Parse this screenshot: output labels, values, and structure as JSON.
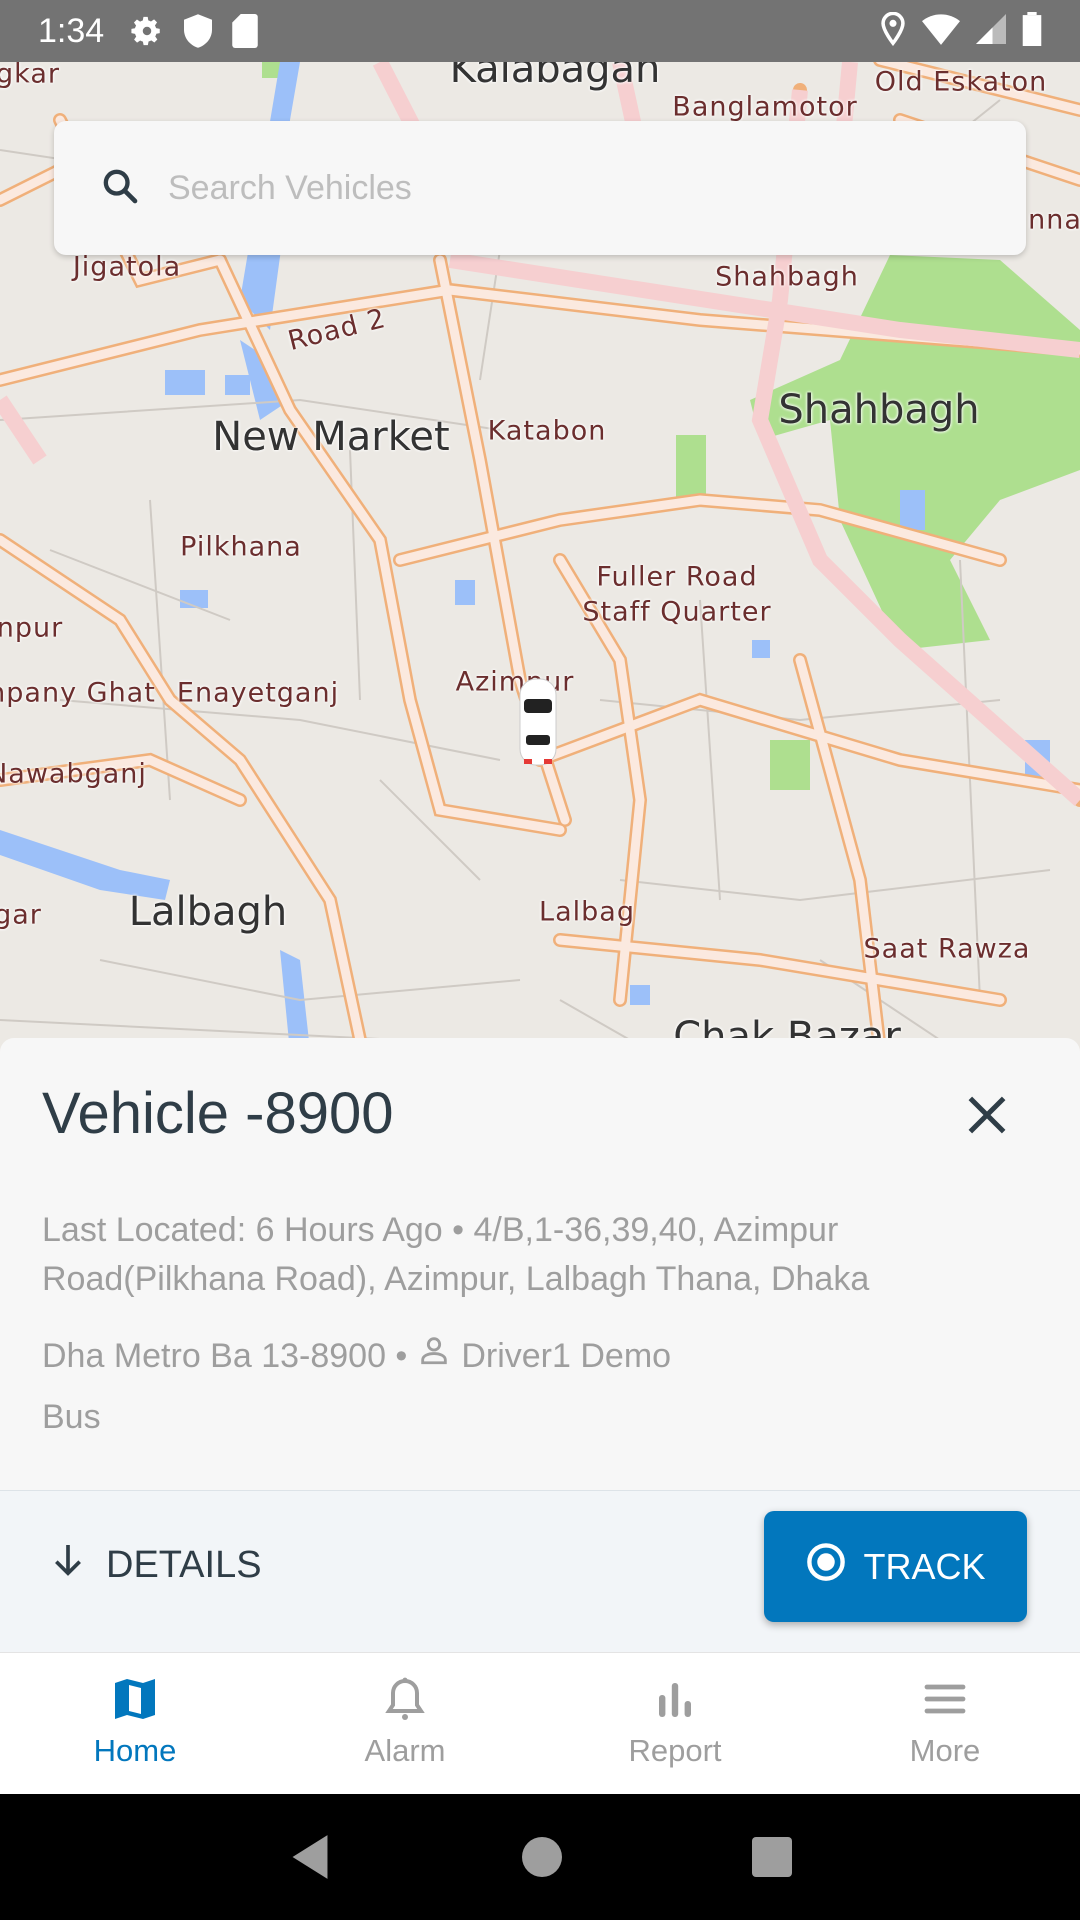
{
  "status_bar": {
    "time": "1:34",
    "icons": [
      "settings-icon",
      "shield-icon",
      "sd-card-icon",
      "location-icon",
      "wifi-icon",
      "signal-icon",
      "battery-icon"
    ]
  },
  "map": {
    "labels": [
      "Kalabagan",
      "Old Eskaton",
      "Banglamotor",
      "Jigatola",
      "Road 2",
      "Shahbagh",
      "Shahbagh",
      "New Market",
      "Katabon",
      "Pilkhana",
      "Fuller Road",
      "Staff Quarter",
      "Azimpur",
      "npur",
      "npany Ghat",
      "Enayetganj",
      "Nawabganj",
      "Lalbagh",
      "gar",
      "Lalbag",
      "Saat Rawza",
      "Chak Bazar",
      "gkar",
      "nna"
    ],
    "marker": "car-icon"
  },
  "search": {
    "placeholder": "Search Vehicles",
    "value": ""
  },
  "vehicle": {
    "title": "Vehicle -8900",
    "location_line": "Last Located: 6 Hours Ago • 4/B,1-36,39,40, Azimpur Road(Pilkhana Road), Azimpur, Lalbagh Thana, Dhaka",
    "registration": "Dha Metro Ba 13-8900 •",
    "driver": "Driver1 Demo",
    "type": "Bus"
  },
  "actions": {
    "details_label": "DETAILS",
    "track_label": "TRACK"
  },
  "bottom_nav": [
    {
      "label": "Home",
      "icon": "map-icon",
      "active": true
    },
    {
      "label": "Alarm",
      "icon": "bell-icon",
      "active": false
    },
    {
      "label": "Report",
      "icon": "bar-chart-icon",
      "active": false
    },
    {
      "label": "More",
      "icon": "menu-icon",
      "active": false
    }
  ],
  "colors": {
    "accent": "#0277bd",
    "title": "#2f3d47",
    "muted": "#9e9e9e",
    "status_bar": "#737373"
  }
}
